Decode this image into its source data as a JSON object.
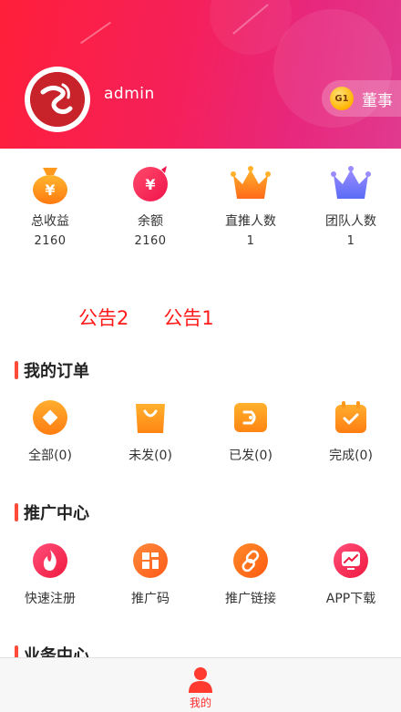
{
  "header": {
    "username": "admin",
    "level_badge": {
      "code": "G1",
      "title": "董事"
    }
  },
  "stats": [
    {
      "icon": "money-bag-icon",
      "label": "总收益",
      "value": "2160"
    },
    {
      "icon": "balance-icon",
      "label": "余额",
      "value": "2160"
    },
    {
      "icon": "crown-icon",
      "label": "直推人数",
      "value": "1"
    },
    {
      "icon": "team-crown-icon",
      "label": "团队人数",
      "value": "1"
    }
  ],
  "notices": [
    "公告2",
    "公告1"
  ],
  "orders": {
    "title": "我的订单",
    "items": [
      {
        "icon": "all-orders-icon",
        "label": "全部(0)"
      },
      {
        "icon": "unshipped-bag-icon",
        "label": "未发(0)"
      },
      {
        "icon": "shipped-icon",
        "label": "已发(0)"
      },
      {
        "icon": "completed-icon",
        "label": "完成(0)"
      }
    ]
  },
  "promotion": {
    "title": "推广中心",
    "items": [
      {
        "icon": "fire-icon",
        "label": "快速注册"
      },
      {
        "icon": "qrcode-icon",
        "label": "推广码"
      },
      {
        "icon": "link-icon",
        "label": "推广链接"
      },
      {
        "icon": "app-download-icon",
        "label": "APP下载"
      }
    ]
  },
  "business": {
    "title": "业务中心"
  },
  "bottom_nav": {
    "label": "我的"
  },
  "colors": {
    "header_start": "#ff1f3a",
    "header_end": "#e03a8f",
    "accent": "#ff4b3a",
    "notice": "#ff1a1a"
  }
}
